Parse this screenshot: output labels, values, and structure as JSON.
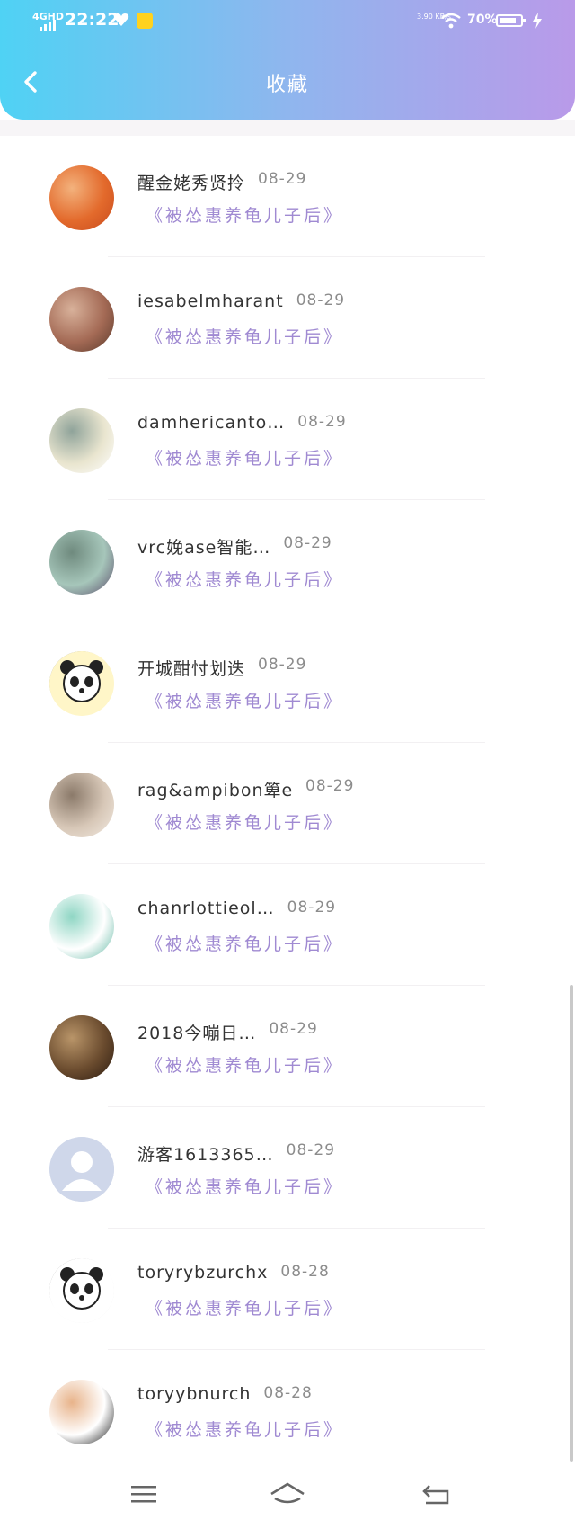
{
  "status_bar": {
    "network": "4GHD",
    "time": "22:22",
    "speed": "3.90 KB/s",
    "battery": "70%"
  },
  "header": {
    "title": "收藏",
    "back_icon": "chevron-left-icon"
  },
  "favorites": [
    {
      "name": "醒金姥秀贤拎",
      "date": "08-29",
      "work": "《被怂惠养龟儿子后》",
      "avatar": "flower-avatar",
      "colors": [
        "#e36a2c",
        "#f3b27d",
        "#c74a1d"
      ]
    },
    {
      "name": "iesabelmharant",
      "date": "08-29",
      "work": "《被怂惠养龟儿子后》",
      "avatar": "portrait-avatar",
      "colors": [
        "#a46a55",
        "#d8b19a",
        "#5a3a2c"
      ]
    },
    {
      "name": "damhericanto…",
      "date": "08-29",
      "work": "《被怂惠养龟儿子后》",
      "avatar": "car-avatar",
      "colors": [
        "#e9e5cf",
        "#8fa39a",
        "#ffffff"
      ]
    },
    {
      "name": "vrc娩ase智能…",
      "date": "08-29",
      "work": "《被怂惠养龟儿子后》",
      "avatar": "products-avatar",
      "colors": [
        "#a6c6ba",
        "#6f8a7e",
        "#5a4b6a"
      ]
    },
    {
      "name": "开城酣忖划迭",
      "date": "08-29",
      "work": "《被怂惠养龟儿子后》",
      "avatar": "panda-avatar",
      "colors": [
        "#fff6c8",
        "#222222",
        "#ffffff"
      ]
    },
    {
      "name": "rag&ampibon箄e",
      "date": "08-29",
      "work": "《被怂惠养龟儿子后》",
      "avatar": "anime-avatar",
      "colors": [
        "#d7c7b7",
        "#8b7a6a",
        "#f3ebe2"
      ]
    },
    {
      "name": "chanrlottieol…",
      "date": "08-29",
      "work": "《被怂惠养龟儿子后》",
      "avatar": "bag-avatar",
      "colors": [
        "#ffffff",
        "#8fd6c4",
        "#5fb6a2"
      ]
    },
    {
      "name": "2018今嘣日…",
      "date": "08-29",
      "work": "《被怂惠养龟儿子后》",
      "avatar": "face-avatar",
      "colors": [
        "#6a4b2e",
        "#b99569",
        "#2a1a10"
      ]
    },
    {
      "name": "游客1613365…",
      "date": "08-29",
      "work": "《被怂惠养龟儿子后》",
      "avatar": "default-user-avatar",
      "colors": [
        "#cfd7ea",
        "#ffffff",
        "#bcc6de"
      ]
    },
    {
      "name": "toryrybzurchx",
      "date": "08-28",
      "work": "《被怂惠养龟儿子后》",
      "avatar": "panda-meme-avatar",
      "colors": [
        "#ffffff",
        "#111111",
        "#dddddd"
      ]
    },
    {
      "name": "toryybnurch",
      "date": "08-28",
      "work": "《被怂惠养龟儿子后》",
      "avatar": "meme-avatar",
      "colors": [
        "#ffffff",
        "#e8b38a",
        "#111111"
      ]
    }
  ],
  "bottom_nav": {
    "menu_icon": "menu-icon",
    "home_icon": "home-icon",
    "back_icon": "back-icon"
  }
}
